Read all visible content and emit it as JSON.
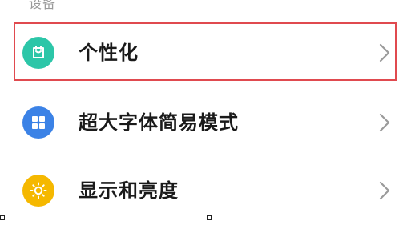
{
  "section": {
    "title": "设备"
  },
  "items": [
    {
      "label": "个性化",
      "icon": "personalize-icon",
      "color": "#2cc6a8",
      "highlighted": true
    },
    {
      "label": "超大字体简易模式",
      "icon": "grid-icon",
      "color": "#3b82e6",
      "highlighted": false
    },
    {
      "label": "显示和亮度",
      "icon": "sun-icon",
      "color": "#f5b800",
      "highlighted": false
    }
  ],
  "colors": {
    "highlight": "#e04a4f",
    "chevron": "#9a9a9a"
  }
}
